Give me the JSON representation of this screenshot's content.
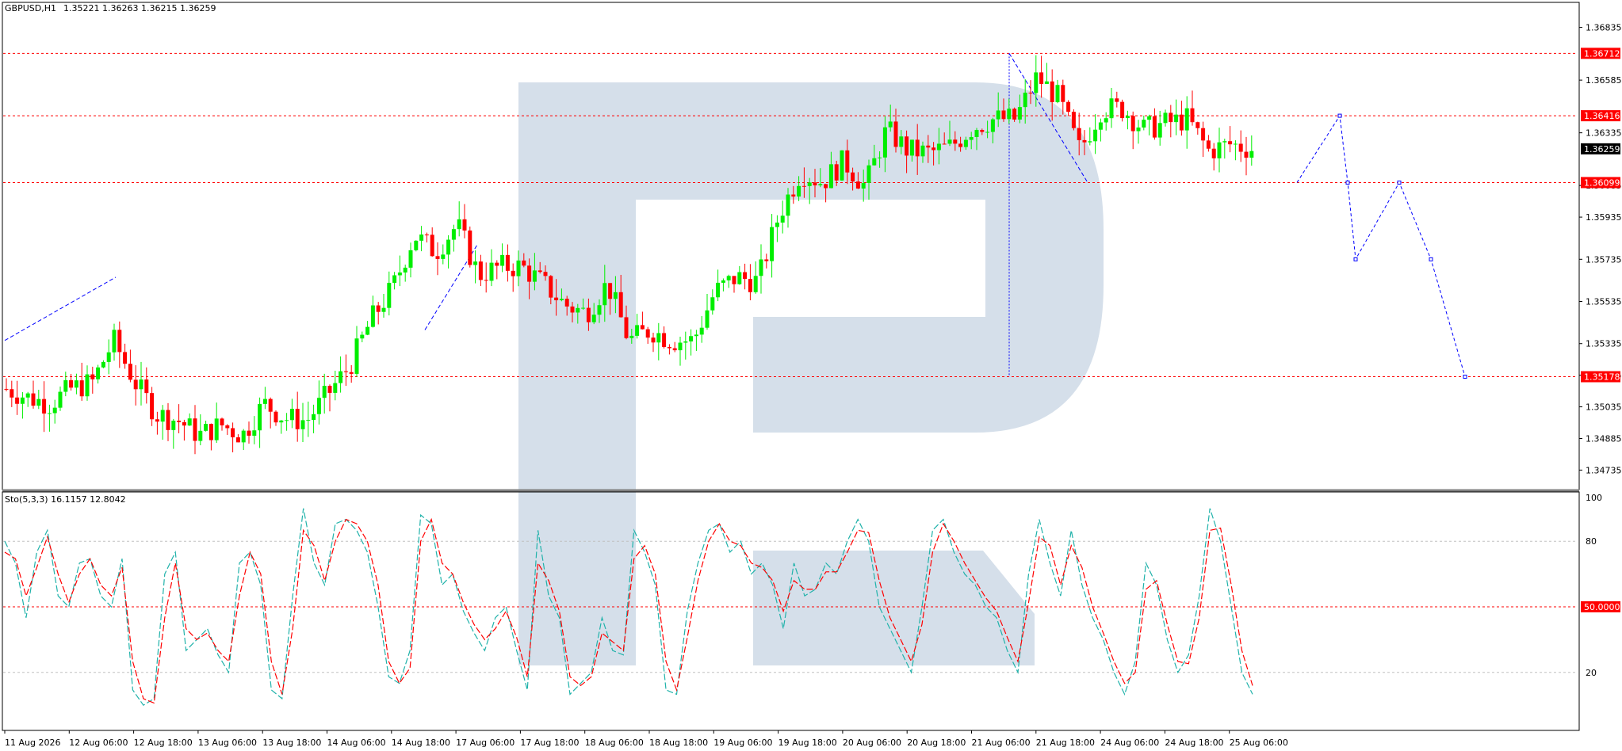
{
  "header": {
    "symbol": "GBPUSD,H1",
    "ohlc": "1.35221 1.36263 1.36215 1.36259"
  },
  "indicator": {
    "title": "Sto(5,3,3) 16.1157 12.8042"
  },
  "colors": {
    "bull": "#00ee00",
    "bear": "#ff0000",
    "level_line": "#ff0000",
    "level_badge": "#ff0000",
    "current_badge": "#000000",
    "forecast": "#0000ff",
    "stoch_main": "#20b2aa",
    "stoch_signal": "#ff0000",
    "watermark": "#d5dfea",
    "grid": "#c0c0c0"
  },
  "chart_data": [
    {
      "type": "candlestick",
      "title": "GBPUSD,H1",
      "ylim": [
        1.3465,
        1.3695
      ],
      "y_ticks": [
        "1.36835",
        "1.36585",
        "1.36335",
        "1.36085",
        "1.35935",
        "1.35735",
        "1.35535",
        "1.35335",
        "1.35185",
        "1.35035",
        "1.34885",
        "1.34735"
      ],
      "x_ticks": [
        "11 Aug 2026",
        "12 Aug 06:00",
        "12 Aug 18:00",
        "13 Aug 06:00",
        "13 Aug 18:00",
        "14 Aug 06:00",
        "14 Aug 18:00",
        "17 Aug 06:00",
        "17 Aug 18:00",
        "18 Aug 06:00",
        "18 Aug 18:00",
        "19 Aug 06:00",
        "19 Aug 18:00",
        "20 Aug 06:00",
        "20 Aug 18:00",
        "21 Aug 06:00",
        "21 Aug 18:00",
        "24 Aug 06:00",
        "24 Aug 18:00",
        "25 Aug 06:00"
      ],
      "levels": [
        {
          "label": "1.36712",
          "value": 1.36712
        },
        {
          "label": "1.36416",
          "value": 1.36416
        },
        {
          "label": "1.36099",
          "value": 1.36099
        },
        {
          "label": "1.35178",
          "value": 1.35178
        }
      ],
      "current_price": {
        "label": "1.36259",
        "value": 1.36259
      },
      "ohlc_anchor_closes": [
        1.3512,
        1.3508,
        1.3505,
        1.3512,
        1.3515,
        1.3535,
        1.3515,
        1.35,
        1.3497,
        1.349,
        1.3495,
        1.349,
        1.3505,
        1.3498,
        1.3497,
        1.351,
        1.3523,
        1.3545,
        1.356,
        1.3585,
        1.3577,
        1.359,
        1.3566,
        1.357,
        1.357,
        1.3562,
        1.3552,
        1.3548,
        1.3562,
        1.3535,
        1.354,
        1.3535,
        1.3535,
        1.3558,
        1.3565,
        1.3563,
        1.3595,
        1.3615,
        1.361,
        1.362,
        1.3608,
        1.3635,
        1.3625,
        1.3624,
        1.3627,
        1.3636,
        1.364,
        1.364,
        1.366,
        1.365,
        1.3625,
        1.3645,
        1.3645,
        1.3635,
        1.3638,
        1.364,
        1.3625,
        1.3628,
        1.3626
      ],
      "forecast_path": [
        [
          1.36099,
          0
        ],
        [
          1.36416,
          0
        ],
        [
          1.36099,
          0
        ],
        [
          1.35735,
          0
        ],
        [
          1.36099,
          0
        ],
        [
          1.35735,
          0
        ],
        [
          1.35178,
          0
        ]
      ],
      "forecast_points": [
        1.36099,
        1.36416,
        1.36099,
        1.35735,
        1.36099,
        1.35735,
        1.35178
      ]
    },
    {
      "type": "line",
      "title": "Sto(5,3,3) 16.1157 12.8042",
      "ylim": [
        0,
        100
      ],
      "y_ticks": [
        "100",
        "80",
        "50.0000",
        "20"
      ],
      "levels": [
        80,
        50,
        20
      ],
      "series": [
        {
          "name": "main",
          "values": [
            80,
            70,
            45,
            75,
            85,
            55,
            50,
            70,
            72,
            55,
            50,
            72,
            12,
            5,
            8,
            65,
            75,
            30,
            35,
            40,
            28,
            20,
            70,
            75,
            60,
            12,
            8,
            55,
            95,
            70,
            60,
            88,
            90,
            85,
            75,
            50,
            18,
            15,
            30,
            92,
            88,
            60,
            65,
            48,
            38,
            30,
            45,
            50,
            30,
            12,
            85,
            55,
            45,
            10,
            15,
            20,
            45,
            30,
            28,
            85,
            75,
            60,
            12,
            10,
            48,
            70,
            85,
            88,
            75,
            80,
            65,
            70,
            60,
            40,
            70,
            55,
            58,
            70,
            65,
            80,
            90,
            80,
            50,
            40,
            30,
            20,
            50,
            85,
            90,
            75,
            65,
            60,
            50,
            45,
            30,
            20,
            65,
            90,
            70,
            55,
            85,
            60,
            45,
            35,
            20,
            10,
            25,
            70,
            60,
            35,
            20,
            28,
            55,
            95,
            80,
            50,
            20,
            10
          ]
        },
        {
          "name": "signal",
          "values": [
            75,
            72,
            55,
            68,
            82,
            65,
            52,
            65,
            72,
            60,
            55,
            68,
            25,
            8,
            6,
            45,
            70,
            40,
            35,
            38,
            30,
            25,
            55,
            75,
            65,
            25,
            10,
            40,
            85,
            78,
            62,
            80,
            90,
            88,
            80,
            60,
            25,
            15,
            22,
            80,
            90,
            70,
            65,
            52,
            42,
            35,
            40,
            48,
            36,
            18,
            70,
            62,
            48,
            18,
            14,
            18,
            38,
            34,
            30,
            72,
            78,
            65,
            25,
            12,
            36,
            62,
            80,
            88,
            80,
            78,
            70,
            68,
            62,
            48,
            62,
            58,
            58,
            66,
            66,
            75,
            85,
            84,
            62,
            45,
            35,
            25,
            42,
            75,
            88,
            80,
            70,
            62,
            54,
            48,
            36,
            25,
            52,
            82,
            78,
            60,
            78,
            68,
            50,
            38,
            25,
            15,
            20,
            58,
            62,
            42,
            25,
            24,
            45,
            85,
            86,
            60,
            30,
            14
          ]
        }
      ]
    }
  ]
}
